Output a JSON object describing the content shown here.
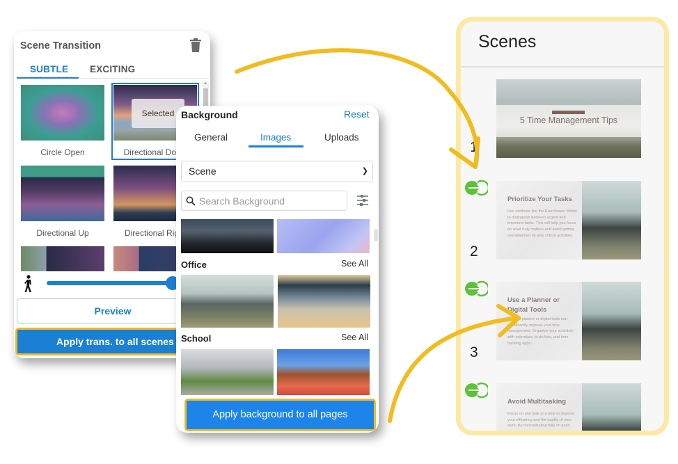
{
  "scene_transition": {
    "title": "Scene Transition",
    "delete_icon": "trash-icon",
    "tabs": [
      {
        "label": "SUBTLE",
        "active": true
      },
      {
        "label": "EXCITING",
        "active": false
      }
    ],
    "items": [
      {
        "label": "Circle Open",
        "selected": false
      },
      {
        "label": "Directional Down",
        "selected": true
      },
      {
        "label": "Directional Up",
        "selected": false
      },
      {
        "label": "Directional Right",
        "selected": false
      },
      {
        "label": "",
        "selected": false
      },
      {
        "label": "",
        "selected": false
      }
    ],
    "selected_badge": "Selected",
    "speed_icon": "walking-person-icon",
    "speed_value_fraction": 0.95,
    "preview_label": "Preview",
    "apply_label": "Apply trans. to all scenes"
  },
  "background": {
    "title": "Background",
    "reset_label": "Reset",
    "tabs": [
      {
        "label": "General",
        "active": false
      },
      {
        "label": "Images",
        "active": true
      },
      {
        "label": "Uploads",
        "active": false
      }
    ],
    "category_select": "Scene",
    "search_placeholder": "Search Background",
    "filter_icon": "sliders-icon",
    "sections": [
      {
        "title": "Office",
        "see_all": "See All"
      },
      {
        "title": "School",
        "see_all": "See All"
      }
    ],
    "apply_label": "Apply background to all pages"
  },
  "scenes": {
    "title": "Scenes",
    "items": [
      {
        "number": "1",
        "cover_title": "5 Time Management Tips",
        "has_transition": false
      },
      {
        "number": "2",
        "heading": "Prioritize Your Tasks",
        "body": "Use methods like the Eisenhower Matrix to distinguish between urgent and important tasks. This will help you focus on what truly matters and avoid getting overwhelmed by less critical activities.",
        "has_transition": true
      },
      {
        "number": "3",
        "heading": "Use a Planner or Digital Tools",
        "body": "Using a planner or digital tools can significantly improve your time management. Organize your schedule with calendars, to-do lists, and time tracking apps.",
        "has_transition": true
      },
      {
        "number": "",
        "heading": "Avoid Multitasking",
        "body": "Focus on one task at a time to improve your efficiency and the quality of your work. By concentrating fully on each",
        "has_transition": true
      }
    ]
  },
  "colors": {
    "accent_blue": "#1c7fd6",
    "highlight_yellow": "#f0b92a",
    "scenes_border": "#fde9a6",
    "transition_green": "#5ec13a"
  }
}
